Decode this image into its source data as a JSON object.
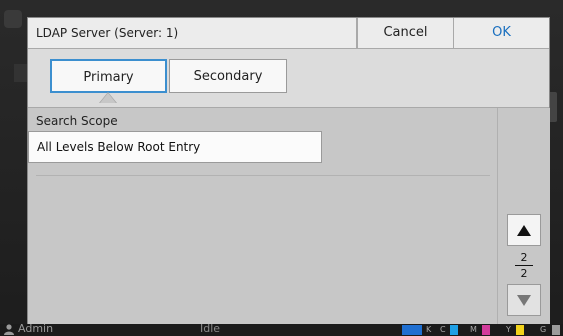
{
  "dialog": {
    "title": "LDAP Server (Server: 1)",
    "cancel_label": "Cancel",
    "ok_label": "OK"
  },
  "tabs": [
    {
      "label": "Primary",
      "selected": true
    },
    {
      "label": "Secondary",
      "selected": false
    }
  ],
  "field": {
    "label": "Search Scope",
    "value": "All Levels Below Root Entry"
  },
  "pager": {
    "current": "2",
    "total": "2"
  },
  "statusbar": {
    "user": "Admin",
    "state": "Idle",
    "ink_labels": [
      "K",
      "C",
      "M",
      "Y",
      "G"
    ],
    "ink_colors": [
      "#1f6fd1",
      "#1fa0e6",
      "#d23c9b",
      "#f2d31b",
      "#9c9c9c"
    ]
  },
  "colors": {
    "accent": "#3c8fcf",
    "ok_text": "#1a6fbf"
  }
}
